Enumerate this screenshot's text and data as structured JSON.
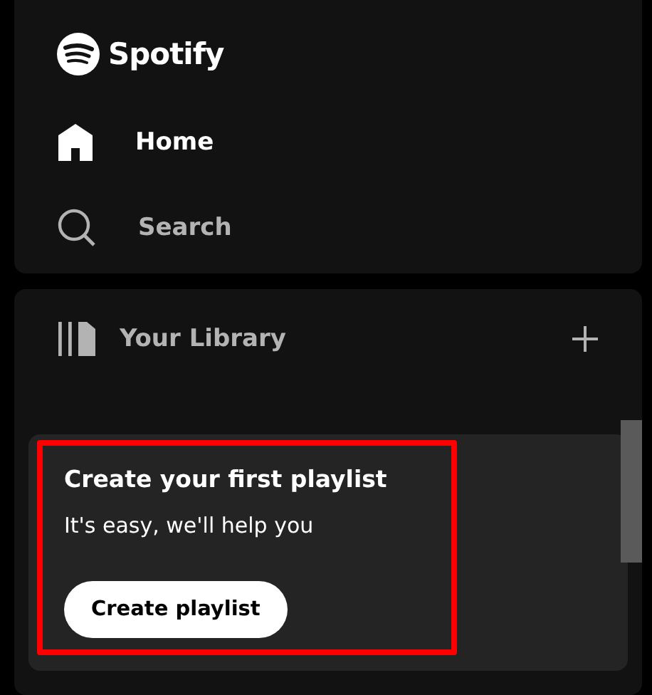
{
  "logo": {
    "text": "Spotify"
  },
  "nav": [
    {
      "kind": "home",
      "label": "Home",
      "selected": true
    },
    {
      "kind": "search",
      "label": "Search",
      "selected": false
    }
  ],
  "library": {
    "title": "Your Library",
    "card": {
      "title": "Create your first playlist",
      "text": "It's easy, we'll help you",
      "button": "Create playlist",
      "highlighted": true
    }
  }
}
